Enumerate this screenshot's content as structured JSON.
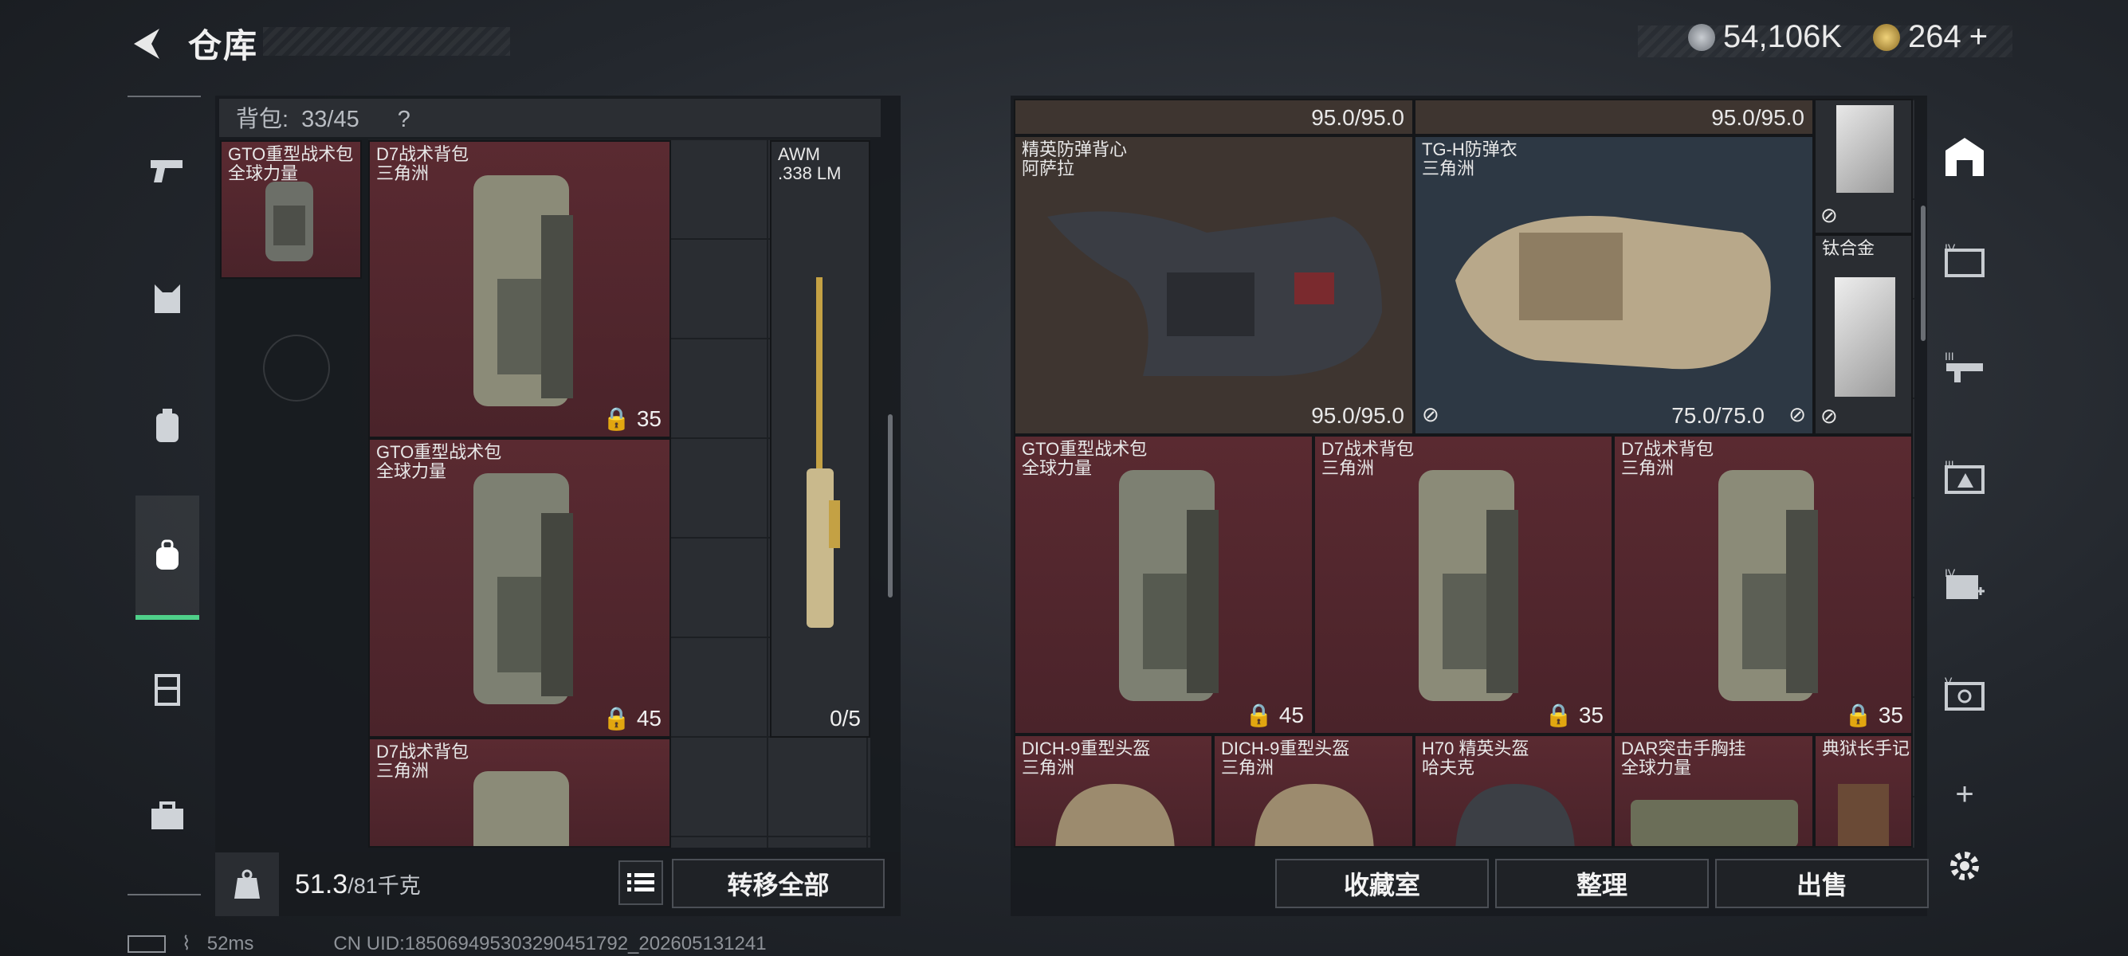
{
  "header": {
    "title": "仓库",
    "currency1": "54,106K",
    "currency2": "264",
    "plus": "+"
  },
  "backpack": {
    "caption_label": "背包:",
    "caption_count": "33/45",
    "caption_help": "?",
    "weight_current": "51.3",
    "weight_max": "/81千克",
    "transfer_all": "转移全部",
    "equipped": {
      "name": "GTO重型战术包\n全球力量"
    },
    "items": [
      {
        "name": "D7战术背包\n三角洲",
        "count": "35"
      },
      {
        "name": "AWM\n.338 LM",
        "count": "0/5"
      },
      {
        "name": "GTO重型战术包\n全球力量",
        "count": "45"
      },
      {
        "name": "D7战术背包\n三角洲",
        "count": ""
      }
    ]
  },
  "storage": {
    "top_durability_1": "95.0/95.0",
    "top_durability_2": "95.0/95.0",
    "items": [
      {
        "name": "精英防弹背心\n阿萨拉",
        "durability": "95.0/95.0"
      },
      {
        "name": "TG-H防弹衣\n三角洲",
        "durability": "75.0/75.0"
      },
      {
        "name": "钛合金"
      },
      {
        "name": "GTO重型战术包\n全球力量",
        "count": "45"
      },
      {
        "name": "D7战术背包\n三角洲",
        "count": "35"
      },
      {
        "name": "D7战术背包\n三角洲",
        "count": "35"
      },
      {
        "name": "DICH-9重型头盔\n三角洲"
      },
      {
        "name": "DICH-9重型头盔\n三角洲"
      },
      {
        "name": "H70 精英头盔\n哈夫克"
      },
      {
        "name": "DAR突击手胸挂\n全球力量"
      },
      {
        "name": "典狱长手记"
      }
    ],
    "buttons": {
      "collection": "收藏室",
      "sort": "整理",
      "sell": "出售"
    }
  },
  "footer": {
    "ping": "52ms",
    "uid": "CN UID:185069495303290451792_202605131241"
  },
  "colors": {
    "accent": "#4fd08a",
    "item_red": "#5a2a31"
  }
}
